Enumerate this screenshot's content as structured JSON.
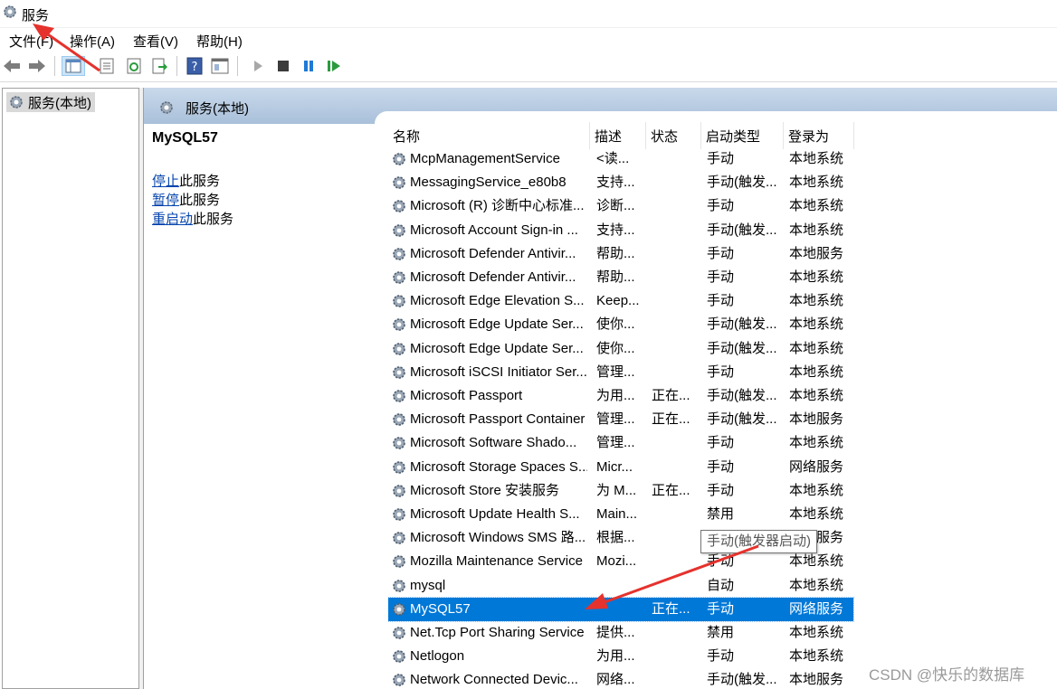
{
  "window": {
    "title": "服务",
    "icon": "gear-icon"
  },
  "menu": [
    "文件(F)",
    "操作(A)",
    "查看(V)",
    "帮助(H)"
  ],
  "toolbar": {
    "buttons": [
      "back-arrow-icon",
      "forward-arrow-icon",
      "show-hide-tree-icon",
      "properties-icon",
      "refresh-icon",
      "export-list-icon",
      "help-icon",
      "console-view-icon",
      "play-icon",
      "stop-icon",
      "pause-icon",
      "restart-icon"
    ]
  },
  "tree": {
    "root_label": "服务(本地)"
  },
  "pane": {
    "header_title": "服务(本地)",
    "selected_service": "MySQL57",
    "actions": [
      {
        "link": "停止",
        "suffix": "此服务"
      },
      {
        "link": "暂停",
        "suffix": "此服务"
      },
      {
        "link": "重启动",
        "suffix": "此服务"
      }
    ]
  },
  "columns": [
    "名称",
    "描述",
    "状态",
    "启动类型",
    "登录为"
  ],
  "rows": [
    {
      "name": "McpManagementService",
      "desc": "<读...",
      "status": "",
      "start": "手动",
      "logon": "本地系统"
    },
    {
      "name": "MessagingService_e80b8",
      "desc": "支持...",
      "status": "",
      "start": "手动(触发...",
      "logon": "本地系统"
    },
    {
      "name": "Microsoft (R) 诊断中心标准...",
      "desc": "诊断...",
      "status": "",
      "start": "手动",
      "logon": "本地系统"
    },
    {
      "name": "Microsoft Account Sign-in ...",
      "desc": "支持...",
      "status": "",
      "start": "手动(触发...",
      "logon": "本地系统"
    },
    {
      "name": "Microsoft Defender Antivir...",
      "desc": "帮助...",
      "status": "",
      "start": "手动",
      "logon": "本地服务"
    },
    {
      "name": "Microsoft Defender Antivir...",
      "desc": "帮助...",
      "status": "",
      "start": "手动",
      "logon": "本地系统"
    },
    {
      "name": "Microsoft Edge Elevation S...",
      "desc": "Keep...",
      "status": "",
      "start": "手动",
      "logon": "本地系统"
    },
    {
      "name": "Microsoft Edge Update Ser...",
      "desc": "使你...",
      "status": "",
      "start": "手动(触发...",
      "logon": "本地系统"
    },
    {
      "name": "Microsoft Edge Update Ser...",
      "desc": "使你...",
      "status": "",
      "start": "手动(触发...",
      "logon": "本地系统"
    },
    {
      "name": "Microsoft iSCSI Initiator Ser...",
      "desc": "管理...",
      "status": "",
      "start": "手动",
      "logon": "本地系统"
    },
    {
      "name": "Microsoft Passport",
      "desc": "为用...",
      "status": "正在...",
      "start": "手动(触发...",
      "logon": "本地系统"
    },
    {
      "name": "Microsoft Passport Container",
      "desc": "管理...",
      "status": "正在...",
      "start": "手动(触发...",
      "logon": "本地服务"
    },
    {
      "name": "Microsoft Software Shado...",
      "desc": "管理...",
      "status": "",
      "start": "手动",
      "logon": "本地系统"
    },
    {
      "name": "Microsoft Storage Spaces S...",
      "desc": "Micr...",
      "status": "",
      "start": "手动",
      "logon": "网络服务"
    },
    {
      "name": "Microsoft Store 安装服务",
      "desc": "为 M...",
      "status": "正在...",
      "start": "手动",
      "logon": "本地系统"
    },
    {
      "name": "Microsoft Update Health S...",
      "desc": "Main...",
      "status": "",
      "start": "禁用",
      "logon": "本地系统"
    },
    {
      "name": "Microsoft Windows SMS 路...",
      "desc": "根据...",
      "status": "",
      "start": "手动(触发...",
      "logon": "本地服务"
    },
    {
      "name": "Mozilla Maintenance Service",
      "desc": "Mozi...",
      "status": "",
      "start": "手动",
      "logon": "本地系统"
    },
    {
      "name": "mysql",
      "desc": "",
      "status": "",
      "start": "自动",
      "logon": "本地系统"
    },
    {
      "name": "MySQL57",
      "desc": "",
      "status": "正在...",
      "start": "手动",
      "logon": "网络服务",
      "selected": true
    },
    {
      "name": "Net.Tcp Port Sharing Service",
      "desc": "提供...",
      "status": "",
      "start": "禁用",
      "logon": "本地系统"
    },
    {
      "name": "Netlogon",
      "desc": "为用...",
      "status": "",
      "start": "手动",
      "logon": "本地系统"
    },
    {
      "name": "Network Connected Devic...",
      "desc": "网络...",
      "status": "",
      "start": "手动(触发...",
      "logon": "本地服务"
    }
  ],
  "tooltip": "手动(触发器启动)",
  "watermark": "CSDN @快乐的数据库",
  "colors": {
    "selection": "#0078d7",
    "link": "#0645ad",
    "annotation_arrow": "#e5322d"
  }
}
